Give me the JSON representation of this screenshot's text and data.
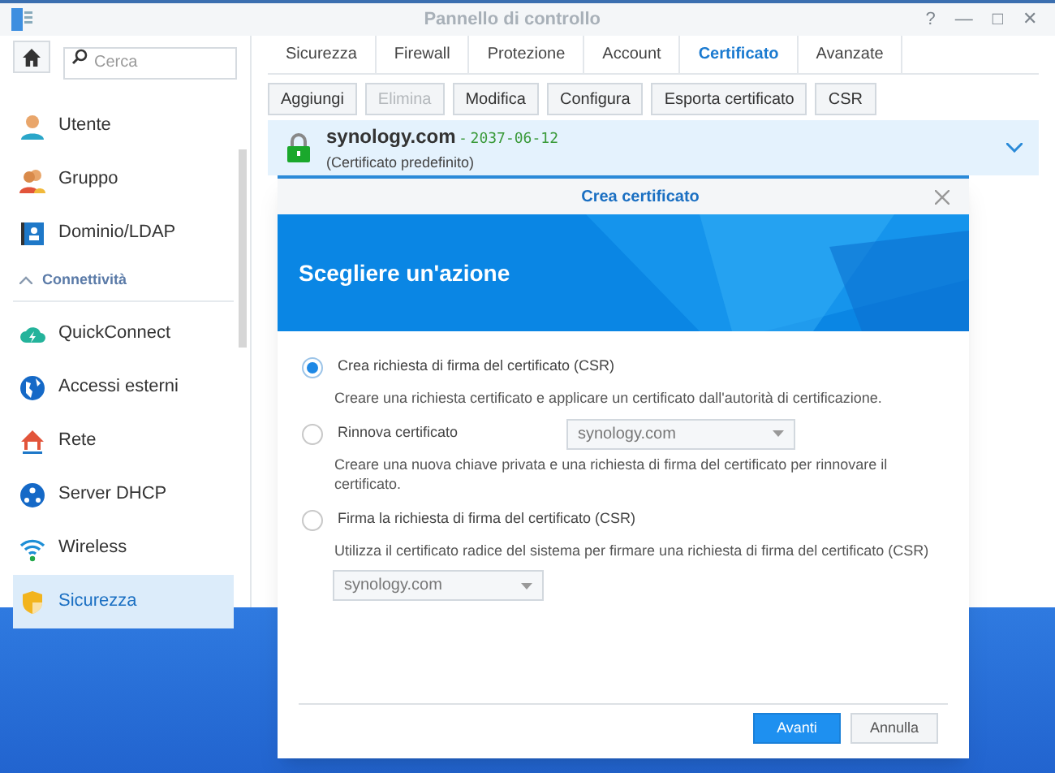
{
  "window": {
    "title": "Pannello di controllo",
    "controls": [
      "?",
      "—",
      "□",
      "✕"
    ]
  },
  "sidebar": {
    "search": {
      "placeholder": "Cerca"
    },
    "items": [
      {
        "kind": "item",
        "label": "Utente",
        "selected": false
      },
      {
        "kind": "item",
        "label": "Gruppo",
        "selected": false
      },
      {
        "kind": "item",
        "label": "Dominio/LDAP",
        "selected": false
      },
      {
        "kind": "section",
        "label": "Connettività",
        "expanded": true
      },
      {
        "kind": "item",
        "label": "QuickConnect",
        "selected": false
      },
      {
        "kind": "item",
        "label": "Accessi esterni",
        "selected": false
      },
      {
        "kind": "item",
        "label": "Rete",
        "selected": false
      },
      {
        "kind": "item",
        "label": "Server DHCP",
        "selected": false
      },
      {
        "kind": "item",
        "label": "Wireless",
        "selected": false
      },
      {
        "kind": "item",
        "label": "Sicurezza",
        "selected": true
      }
    ]
  },
  "tabs": [
    {
      "label": "Sicurezza",
      "selected": false
    },
    {
      "label": "Firewall",
      "selected": false
    },
    {
      "label": "Protezione",
      "selected": false
    },
    {
      "label": "Account",
      "selected": false
    },
    {
      "label": "Certificato",
      "selected": true
    },
    {
      "label": "Avanzate",
      "selected": false
    }
  ],
  "toolbar": [
    {
      "label": "Aggiungi",
      "disabled": false
    },
    {
      "label": "Elimina",
      "disabled": true
    },
    {
      "label": "Modifica",
      "disabled": false
    },
    {
      "label": "Configura",
      "disabled": false
    },
    {
      "label": "Esporta certificato",
      "disabled": false
    },
    {
      "label": "CSR",
      "disabled": false
    }
  ],
  "certificate": {
    "name": "synology.com",
    "separator": "-",
    "expiry": "2037-06-12",
    "note": "(Certificato predefinito)"
  },
  "dialog": {
    "title": "Crea certificato",
    "heading": "Scegliere un'azione",
    "options": [
      {
        "label": "Crea richiesta di firma del certificato (CSR)",
        "selected": true,
        "description": "Creare una richiesta certificato e applicare un certificato dall'autorità di certificazione."
      },
      {
        "label": "Rinnova certificato",
        "selected": false,
        "inline_select": "synology.com",
        "description": "Creare una nuova chiave privata e una richiesta di firma del certificato per rinnovare il certificato."
      },
      {
        "label": "Firma la richiesta di firma del certificato (CSR)",
        "selected": false,
        "description": "Utilizza il certificato radice del sistema per firmare una richiesta di firma del certificato (CSR)",
        "below_select": "synology.com"
      }
    ],
    "buttons": [
      {
        "label": "Avanti",
        "primary": true
      },
      {
        "label": "Annulla",
        "primary": false
      }
    ]
  }
}
